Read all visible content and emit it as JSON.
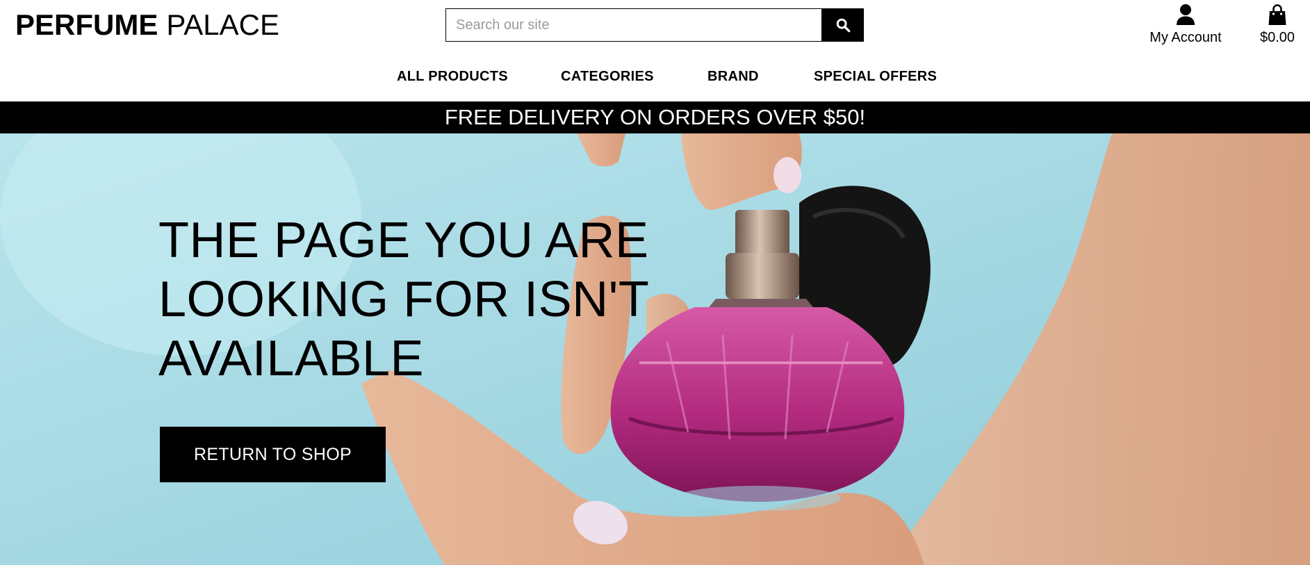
{
  "header": {
    "logo_bold": "PERFUME",
    "logo_light": "PALACE",
    "search_placeholder": "Search our site",
    "search_icon": "search-icon",
    "account_label": "My Account",
    "account_icon": "user-icon",
    "bag_total": "$0.00",
    "bag_icon": "shopping-bag-icon"
  },
  "nav": {
    "items": [
      {
        "label": "ALL PRODUCTS"
      },
      {
        "label": "CATEGORIES"
      },
      {
        "label": "BRAND"
      },
      {
        "label": "SPECIAL OFFERS"
      }
    ]
  },
  "banner": {
    "text": "FREE DELIVERY ON ORDERS OVER $50!"
  },
  "hero": {
    "title": "THE PAGE YOU ARE LOOKING FOR ISN'T AVAILABLE",
    "button_label": "RETURN TO SHOP"
  },
  "colors": {
    "primary": "#000000",
    "background": "#ffffff",
    "hero_sky": "#a6dbe5",
    "perfume": "#b0287a"
  }
}
